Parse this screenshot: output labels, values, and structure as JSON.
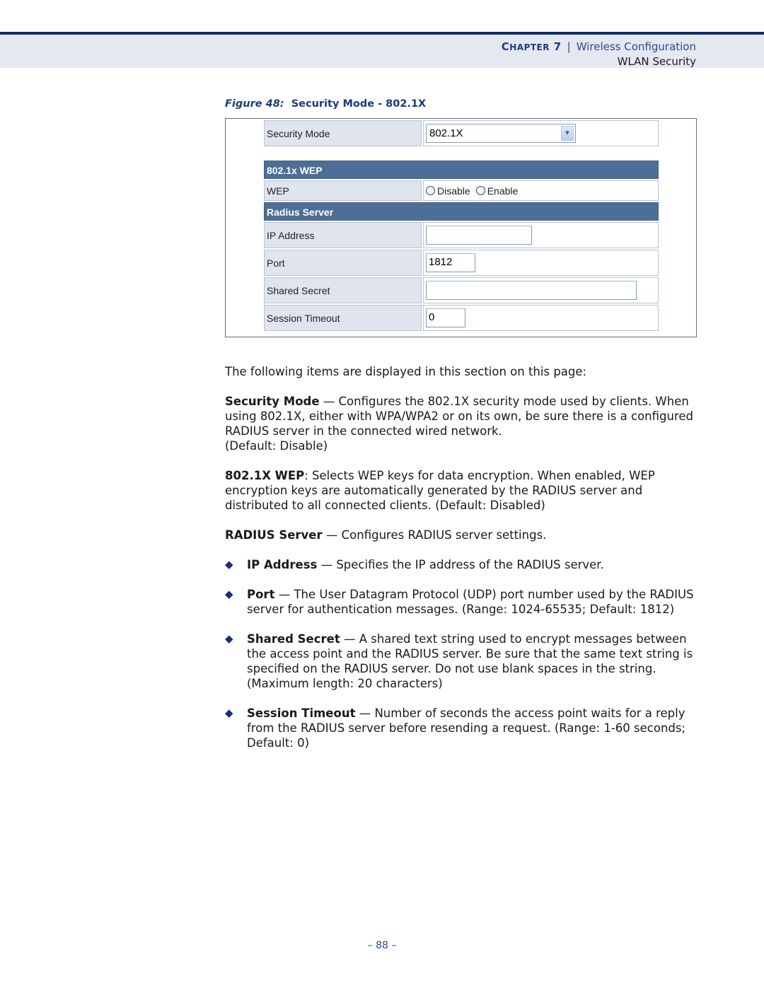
{
  "header": {
    "chapter_prefix": "C",
    "chapter_rest": "HAPTER",
    "chapter_number": "7",
    "separator": "|",
    "chapter_title": "Wireless Configuration",
    "section_title": "WLAN Security"
  },
  "figure": {
    "label": "Figure 48:",
    "title": "Security Mode - 802.1X",
    "form": {
      "security_mode": {
        "label": "Security Mode",
        "value": "802.1X"
      },
      "wep_section": {
        "title": "802.1x WEP"
      },
      "wep": {
        "label": "WEP",
        "options": [
          "Disable",
          "Enable"
        ]
      },
      "radius_section": {
        "title": "Radius Server"
      },
      "ip_address": {
        "label": "IP Address",
        "value": ""
      },
      "port": {
        "label": "Port",
        "value": "1812"
      },
      "shared_secret": {
        "label": "Shared Secret",
        "value": ""
      },
      "session_timeout": {
        "label": "Session Timeout",
        "value": "0"
      }
    }
  },
  "body": {
    "intro": "The following items are displayed in this section on this page:",
    "security_mode": {
      "term": "Security Mode",
      "text": " — Configures the 802.1X security mode used by clients. When using 802.1X, either with WPA/WPA2 or on its own, be sure there is a configured RADIUS server in the connected wired network.",
      "default": "(Default: Disable)"
    },
    "wep": {
      "term": "802.1X WEP",
      "text": ": Selects WEP keys for data encryption. When enabled, WEP encryption keys are automatically generated by the RADIUS server and distributed to all connected clients. (Default: Disabled)"
    },
    "radius": {
      "term": "RADIUS Server",
      "text": " — Configures RADIUS server settings."
    },
    "bullets": [
      {
        "term": "IP Address",
        "text": " — Specifies the IP address of the RADIUS server."
      },
      {
        "term": "Port",
        "text": " — The User Datagram Protocol (UDP) port number used by the RADIUS server for authentication messages. (Range: 1024-65535; Default: 1812)"
      },
      {
        "term": "Shared Secret",
        "text": " — A shared text string used to encrypt messages between the access point and the RADIUS server. Be sure that the same text string is specified on the RADIUS server. Do not use blank spaces in the string. (Maximum length: 20 characters)"
      },
      {
        "term": "Session Timeout",
        "text": " — Number of seconds the access point waits for a reply from the RADIUS server before resending a request. (Range: 1-60 seconds; Default: 0)"
      }
    ],
    "bullet_glyph": "◆"
  },
  "footer": {
    "page_number": "–  88  –"
  }
}
